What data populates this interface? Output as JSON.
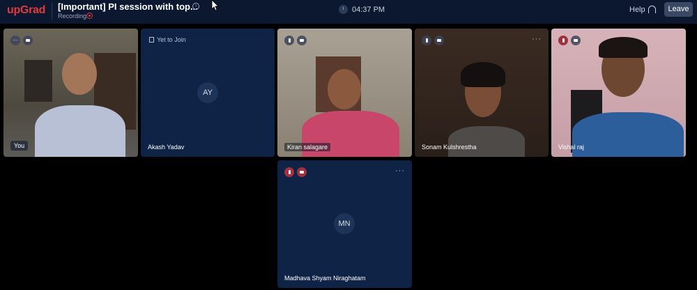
{
  "header": {
    "logo": "upGrad",
    "title": "[Important] PI session with top...",
    "info_icon": "info-icon",
    "recording_label": "Recording",
    "time": "04:37 PM",
    "help_label": "Help",
    "leave_label": "Leave"
  },
  "tiles": [
    {
      "name": "You",
      "type": "video",
      "icons": [
        "more-icon",
        "camera-icon"
      ]
    },
    {
      "name": "Akash Yadav",
      "type": "avatar",
      "initials": "AY",
      "status": "Yet to Join"
    },
    {
      "name": "Kiran salagare",
      "type": "video",
      "icons": [
        "mic-icon",
        "camera-icon"
      ]
    },
    {
      "name": "Sonam Kulshrestha",
      "type": "video",
      "icons": [
        "mic-icon",
        "camera-icon"
      ]
    },
    {
      "name": "Vishal raj",
      "type": "video",
      "icons": [
        "mic-muted-icon",
        "camera-icon"
      ]
    },
    {
      "name": "Madhava Shyam Niraghatam",
      "type": "avatar",
      "initials": "MN",
      "icons": [
        "mic-muted-icon",
        "camera-off-icon"
      ]
    }
  ],
  "colors": {
    "brand": "#e2393e",
    "topbar": "#0b1830",
    "tile": "#0e2346",
    "muted": "#a23140"
  }
}
